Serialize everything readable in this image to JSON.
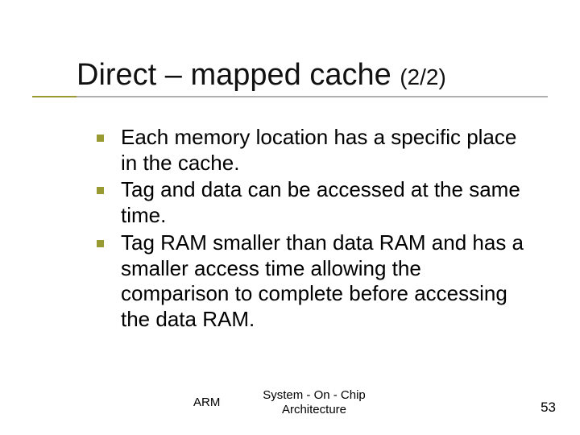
{
  "title": {
    "main": "Direct – mapped cache",
    "sub": "(2/2)"
  },
  "bullets": [
    "Each memory location has a specific place in the cache.",
    "Tag and data can be accessed at the same time.",
    "Tag RAM smaller than data RAM and has a smaller access time allowing the comparison to complete before accessing the data RAM."
  ],
  "footer": {
    "left": "ARM",
    "center": "System - On - Chip Architecture",
    "page": "53"
  }
}
